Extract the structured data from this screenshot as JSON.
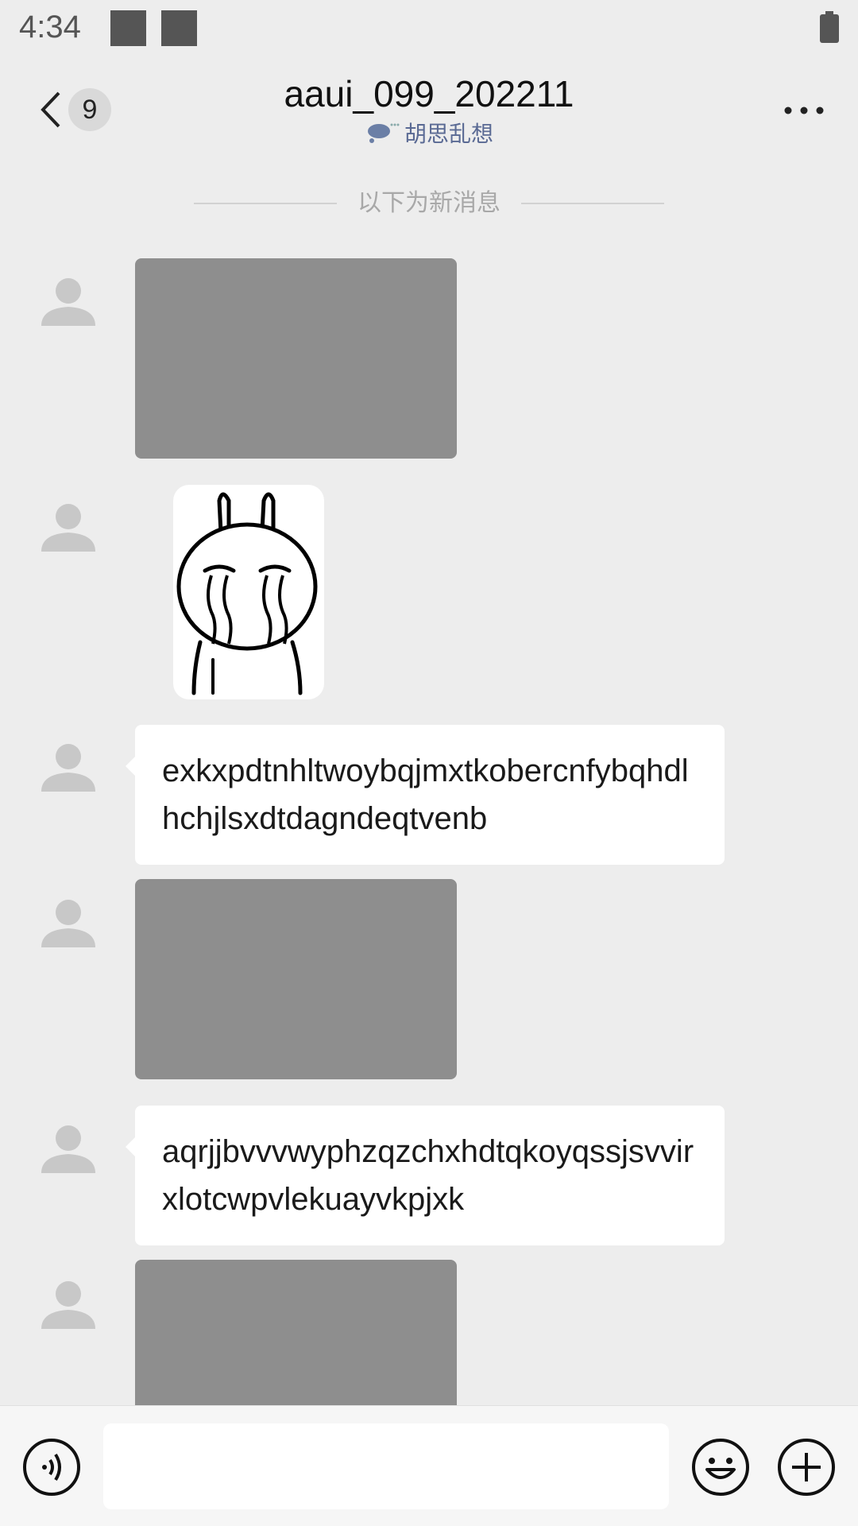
{
  "status_bar": {
    "time": "4:34"
  },
  "header": {
    "unread_count": "9",
    "title": "aaui_099_202211",
    "subtitle": "胡思乱想",
    "icons": {
      "back": "chevron-left-icon",
      "more": "more-dots-icon",
      "status": "thought-bubble-icon"
    }
  },
  "divider": {
    "label": "以下为新消息"
  },
  "messages": [
    {
      "type": "image"
    },
    {
      "type": "sticker",
      "icon": "crying-rabbit-sticker"
    },
    {
      "type": "text",
      "text": "exkxpdtnhltwoybqjmxtkobercnfybqhdlhchjlsxdtdagndeqtvenb"
    },
    {
      "type": "image"
    },
    {
      "type": "text",
      "text": "aqrjjbvvvwyphzqzchxhdtqkoyqssjsvvirxlotcwpvlekuayvkpjxk"
    },
    {
      "type": "image"
    }
  ],
  "input_bar": {
    "value": "",
    "icons": {
      "voice": "voice-icon",
      "emoji": "emoji-icon",
      "plus": "plus-icon"
    }
  },
  "colors": {
    "background": "#ededed",
    "image_placeholder": "#8e8e8e",
    "bubble": "#ffffff",
    "subtitle": "#5a6a94",
    "avatar": "#c8c8c8"
  }
}
